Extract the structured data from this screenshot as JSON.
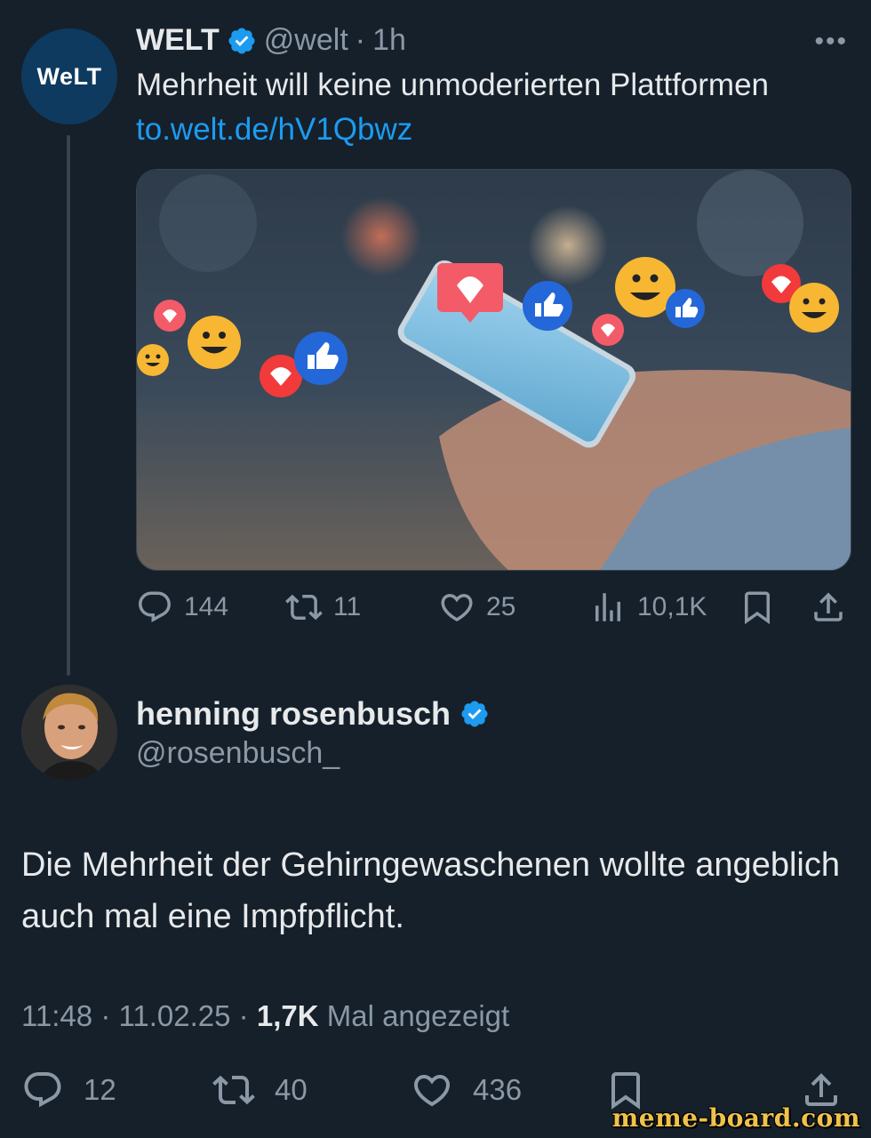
{
  "parent_tweet": {
    "avatar_text": "WeLT",
    "name": "WELT",
    "handle": "@welt",
    "separator": "·",
    "time_ago": "1h",
    "more_icon": "more-dots-icon",
    "text": "Mehrheit will keine unmoderierten Plattformen",
    "link": "to.welt.de/hV1Qbwz",
    "stats": {
      "replies": "144",
      "retweets": "11",
      "likes": "25",
      "views": "10,1K"
    }
  },
  "main_tweet": {
    "name": "henning rosenbusch",
    "handle": "@rosenbusch_",
    "text": "Die Mehrheit der Gehirngewaschenen wollte angeblich auch mal eine Impfpflicht.",
    "time": "11:48",
    "date": "11.02.25",
    "dot": "·",
    "views_count": "1,7K",
    "views_label": "Mal angezeigt",
    "stats": {
      "replies": "12",
      "retweets": "40",
      "likes": "436"
    }
  },
  "watermark": "meme-board.com",
  "colors": {
    "background": "#15202b",
    "text": "#e7e9ea",
    "muted": "#8b98a5",
    "link": "#1d9bf0",
    "verified": "#1d9bf0"
  }
}
